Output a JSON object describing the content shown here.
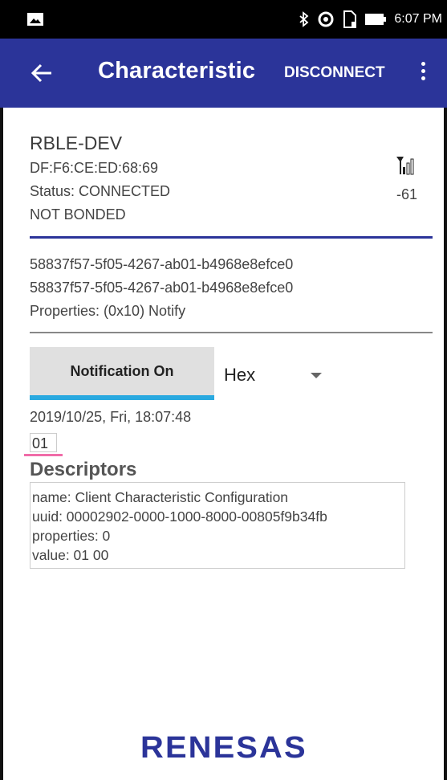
{
  "status_bar": {
    "time": "6:07 PM"
  },
  "app_bar": {
    "title": "Characteristic",
    "disconnect_label": "DISCONNECT"
  },
  "device": {
    "name": "RBLE-DEV",
    "address": "DF:F6:CE:ED:68:69",
    "status": "Status:  CONNECTED",
    "bond": "NOT BONDED",
    "rssi": "-61"
  },
  "characteristic": {
    "uuid1": "58837f57-5f05-4267-ab01-b4968e8efce0",
    "uuid2": "58837f57-5f05-4267-ab01-b4968e8efce0",
    "properties": "Properties: (0x10) Notify"
  },
  "notification": {
    "button_label": "Notification On",
    "format": "Hex",
    "timestamp": "2019/10/25, Fri, 18:07:48",
    "value": "01"
  },
  "descriptors": {
    "title": "Descriptors",
    "items": [
      "name: Client Characteristic Configuration",
      "uuid: 00002902-0000-1000-8000-00805f9b34fb",
      "properties: 0",
      "value: 01 00"
    ]
  },
  "logo": "RENESAS",
  "colors": {
    "app_bar": "#2b3499",
    "button_underline": "#29a9e0",
    "highlight": "#f06ca8"
  }
}
